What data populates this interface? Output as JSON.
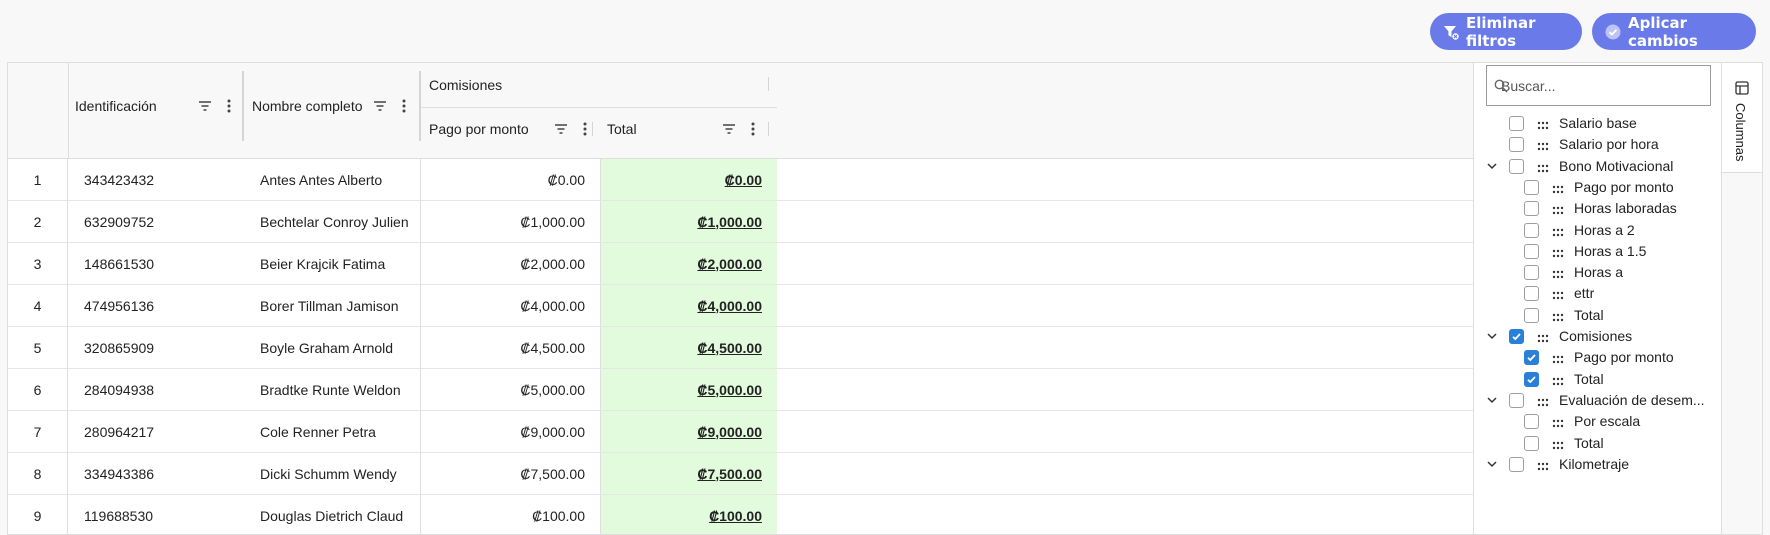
{
  "toolbar": {
    "clear_filters_label": "Eliminar filtros",
    "apply_changes_label": "Aplicar cambios",
    "accent_color": "#6a7ae8"
  },
  "grid": {
    "columns": {
      "id": "Identificación",
      "name": "Nombre completo",
      "group_comisiones": "Comisiones",
      "pago": "Pago por monto",
      "total": "Total"
    },
    "rows": [
      {
        "n": "1",
        "id": "343423432",
        "name": "Antes Antes Alberto",
        "pago": "₡0.00",
        "total": "₡0.00"
      },
      {
        "n": "2",
        "id": "632909752",
        "name": "Bechtelar Conroy Julien",
        "pago": "₡1,000.00",
        "total": "₡1,000.00"
      },
      {
        "n": "3",
        "id": "148661530",
        "name": "Beier Krajcik Fatima",
        "pago": "₡2,000.00",
        "total": "₡2,000.00"
      },
      {
        "n": "4",
        "id": "474956136",
        "name": "Borer Tillman Jamison",
        "pago": "₡4,000.00",
        "total": "₡4,000.00"
      },
      {
        "n": "5",
        "id": "320865909",
        "name": "Boyle Graham Arnold",
        "pago": "₡4,500.00",
        "total": "₡4,500.00"
      },
      {
        "n": "6",
        "id": "284094938",
        "name": "Bradtke Runte Weldon",
        "pago": "₡5,000.00",
        "total": "₡5,000.00"
      },
      {
        "n": "7",
        "id": "280964217",
        "name": "Cole Renner Petra",
        "pago": "₡9,000.00",
        "total": "₡9,000.00"
      },
      {
        "n": "8",
        "id": "334943386",
        "name": "Dicki Schumm Wendy",
        "pago": "₡7,500.00",
        "total": "₡7,500.00"
      },
      {
        "n": "9",
        "id": "119688530",
        "name": "Douglas Dietrich Claud",
        "pago": "₡100.00",
        "total": "₡100.00"
      }
    ],
    "total_bg_color": "#e2fbdd"
  },
  "columns_panel": {
    "search_placeholder": "Buscar...",
    "tab_label": "Columnas",
    "items": [
      {
        "label": "Salario base",
        "level": 0,
        "checked": false,
        "expandable": false
      },
      {
        "label": "Salario por hora",
        "level": 0,
        "checked": false,
        "expandable": false
      },
      {
        "label": "Bono Motivacional",
        "level": 0,
        "checked": false,
        "expandable": true
      },
      {
        "label": "Pago por monto",
        "level": 1,
        "checked": false,
        "expandable": false
      },
      {
        "label": "Horas laboradas",
        "level": 1,
        "checked": false,
        "expandable": false
      },
      {
        "label": "Horas a 2",
        "level": 1,
        "checked": false,
        "expandable": false
      },
      {
        "label": "Horas a 1.5",
        "level": 1,
        "checked": false,
        "expandable": false
      },
      {
        "label": "Horas a",
        "level": 1,
        "checked": false,
        "expandable": false
      },
      {
        "label": "ettr",
        "level": 1,
        "checked": false,
        "expandable": false
      },
      {
        "label": "Total",
        "level": 1,
        "checked": false,
        "expandable": false
      },
      {
        "label": "Comisiones",
        "level": 0,
        "checked": true,
        "expandable": true
      },
      {
        "label": "Pago por monto",
        "level": 1,
        "checked": true,
        "expandable": false
      },
      {
        "label": "Total",
        "level": 1,
        "checked": true,
        "expandable": false
      },
      {
        "label": "Evaluación de desem...",
        "level": 0,
        "checked": false,
        "expandable": true
      },
      {
        "label": "Por escala",
        "level": 1,
        "checked": false,
        "expandable": false
      },
      {
        "label": "Total",
        "level": 1,
        "checked": false,
        "expandable": false
      },
      {
        "label": "Kilometraje",
        "level": 0,
        "checked": false,
        "expandable": true
      }
    ],
    "check_color": "#2a80d8"
  }
}
